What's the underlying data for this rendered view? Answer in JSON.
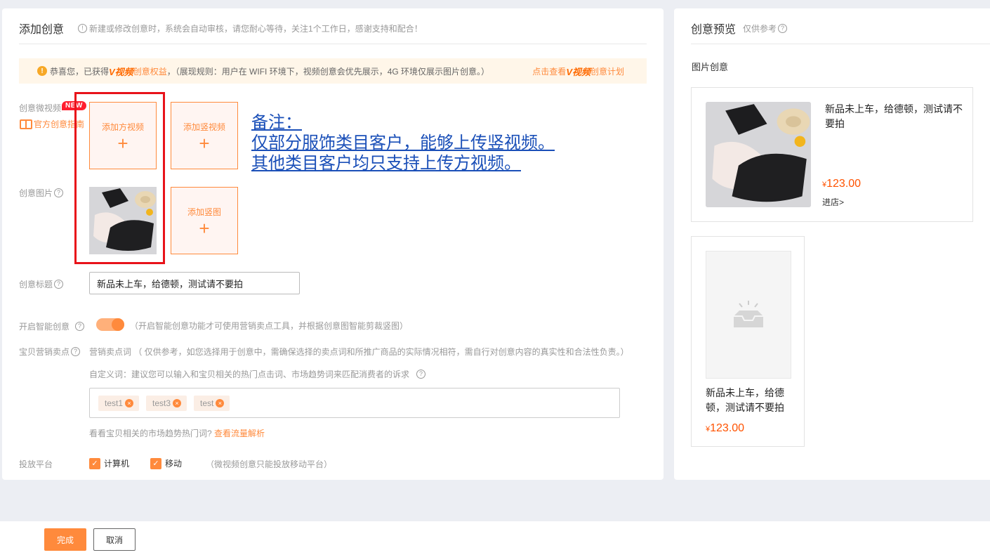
{
  "left": {
    "title": "添加创意",
    "note": "新建或修改创意时，系统会自动审核，请您耐心等待，关注1个工作日，感谢支持和配合！",
    "banner": {
      "prefix": "恭喜您，已获得",
      "logo": "V视频",
      "benefit": "创意权益",
      "rule": "，（展现规则：用户在 WIFI 环境下，视频创意会优先展示，4G 环境仅展示图片创意。）",
      "link_prefix": "点击查看",
      "link_logo": "V视频",
      "link_suffix": "创意计划"
    },
    "video_label": "创意微视频",
    "new_badge": "NEW",
    "guide_link": "官方创意指南",
    "add_square_video": "添加方视频",
    "add_vertical_video": "添加竖视频",
    "image_label": "创意图片",
    "add_vertical_image": "添加竖图",
    "remark": [
      "备注：",
      "仅部分服饰类目客户，能够上传竖视频。",
      "其他类目客户均只支持上传方视频。"
    ],
    "title_label": "创意标题",
    "title_value": "新品未上车，给德顿，测试请不要拍",
    "smart_label": "开启智能创意",
    "smart_hint": "（开启智能创意功能才可使用营销卖点工具，并根据创意图智能剪裁竖图）",
    "selling_label": "宝贝营销卖点",
    "selling_hint": "营销卖点词 （ 仅供参考，如您选择用于创意中，需确保选择的卖点词和所推广商品的实际情况相符，需自行对创意内容的真实性和合法性负责。）",
    "custom_hint": "自定义词：建议您可以输入和宝贝相关的热门点击词、市场趋势词来匹配消费者的诉求",
    "tags": [
      "test1",
      "test3",
      "test"
    ],
    "trend_hint": "看看宝贝相关的市场趋势热门词?",
    "trend_link": "查看流量解析",
    "platform_label": "投放平台",
    "platform_pc": "计算机",
    "platform_mobile": "移动",
    "platform_hint": "（微视频创意只能投放移动平台）"
  },
  "right": {
    "title": "创意预览",
    "subtitle": "仅供参考",
    "section": "图片创意",
    "card1": {
      "title": "新品未上车，给德顿，测试请不要拍",
      "currency": "¥",
      "price": "123.00",
      "store": "进店>"
    },
    "card2": {
      "title": "新品未上车，给德顿，测试请不要拍",
      "currency": "¥",
      "price": "123.00"
    }
  },
  "footer": {
    "done": "完成",
    "cancel": "取消"
  },
  "colors": {
    "accent": "#ff8a3c",
    "highlight_box": "#e8131a",
    "price": "#ff5200",
    "note_link": "#1a4fb8"
  }
}
